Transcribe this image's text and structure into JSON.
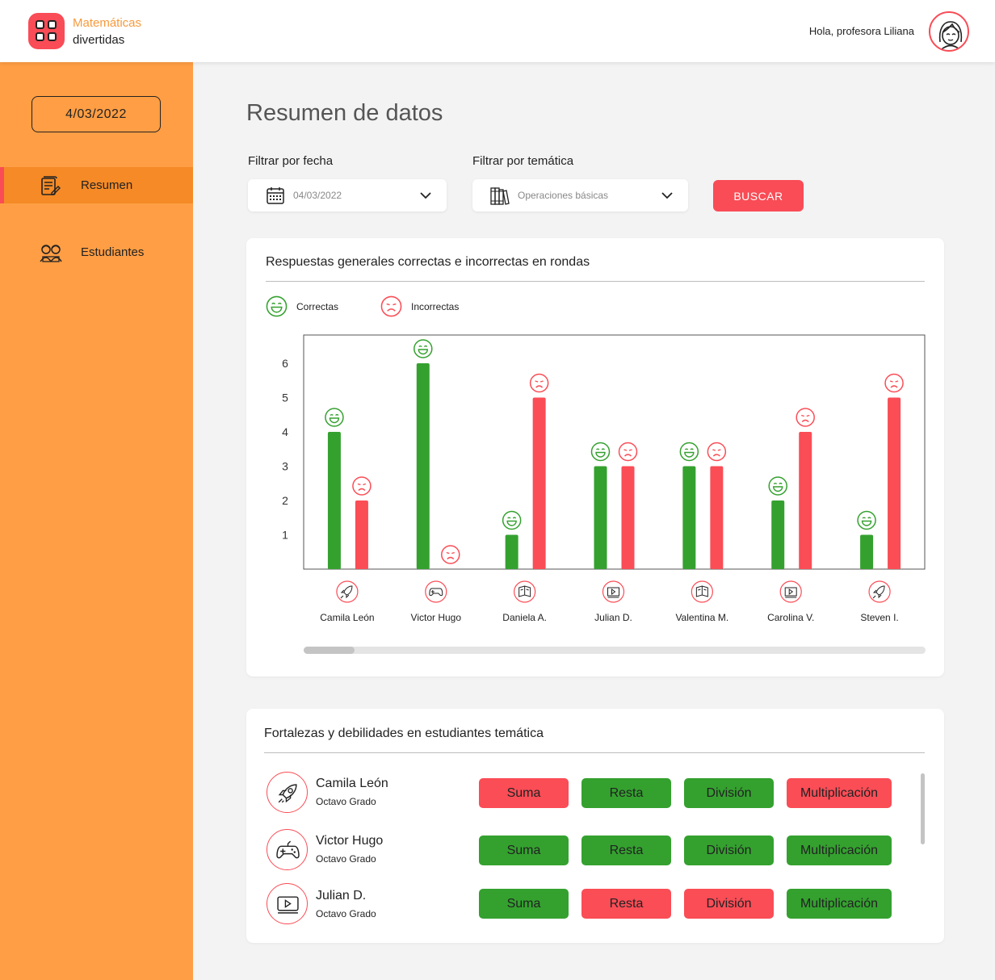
{
  "brand": {
    "line1": "Matemáticas",
    "line2": "divertidas"
  },
  "header": {
    "greeting": "Hola, profesora Liliana"
  },
  "sidebar": {
    "date": "4/03/2022",
    "items": [
      {
        "label": "Resumen",
        "icon": "report-icon",
        "active": true
      },
      {
        "label": "Estudiantes",
        "icon": "students-icon",
        "active": false
      }
    ]
  },
  "page": {
    "title": "Resumen de datos"
  },
  "filters": {
    "date_label": "Filtrar por fecha",
    "date_value": "04/03/2022",
    "topic_label": "Filtrar por temática",
    "topic_value": "Operaciones básicas",
    "search_label": "BUSCAR"
  },
  "colors": {
    "correct": "#34a12f",
    "incorrect": "#fa4d56",
    "orange": "#ff9e44",
    "accent": "#f94c56"
  },
  "chart_card": {
    "title": "Respuestas generales correctas e incorrectas en rondas",
    "legend": [
      {
        "label": "Correctas",
        "icon": "happy-face-icon"
      },
      {
        "label": "Incorrectas",
        "icon": "sad-face-icon"
      }
    ]
  },
  "chart_data": {
    "type": "bar",
    "title": "Respuestas generales correctas e incorrectas en rondas",
    "categories": [
      "Camila León",
      "Victor Hugo",
      "Daniela A.",
      "Julian D.",
      "Valentina M.",
      "Carolina V.",
      "Steven I."
    ],
    "category_icons": [
      "rocket-icon",
      "gamepad-icon",
      "book-icon",
      "video-icon",
      "book-icon",
      "video-icon",
      "rocket-icon"
    ],
    "series": [
      {
        "name": "Correctas",
        "values": [
          4,
          6,
          1,
          3,
          3,
          2,
          1
        ]
      },
      {
        "name": "Incorrectas",
        "values": [
          2,
          0,
          5,
          3,
          3,
          4,
          5
        ]
      }
    ],
    "yticks": [
      1,
      2,
      3,
      4,
      5,
      6
    ],
    "ylim": [
      0,
      6.5
    ],
    "legend": "top-left"
  },
  "strengths_card": {
    "title": "Fortalezas y debilidades en estudiantes temática",
    "students": [
      {
        "name": "Camila León",
        "grade": "Octavo Grado",
        "icon": "rocket-icon",
        "topics": [
          {
            "label": "Suma",
            "status": "bad"
          },
          {
            "label": "Resta",
            "status": "good"
          },
          {
            "label": "División",
            "status": "good"
          },
          {
            "label": "Multiplicación",
            "status": "bad"
          }
        ]
      },
      {
        "name": "Victor Hugo",
        "grade": "Octavo Grado",
        "icon": "gamepad-icon",
        "topics": [
          {
            "label": "Suma",
            "status": "good"
          },
          {
            "label": "Resta",
            "status": "good"
          },
          {
            "label": "División",
            "status": "good"
          },
          {
            "label": "Multiplicación",
            "status": "good"
          }
        ]
      },
      {
        "name": "Julian D.",
        "grade": "Octavo Grado",
        "icon": "video-icon",
        "topics": [
          {
            "label": "Suma",
            "status": "good"
          },
          {
            "label": "Resta",
            "status": "bad"
          },
          {
            "label": "División",
            "status": "bad"
          },
          {
            "label": "Multiplicación",
            "status": "good"
          }
        ]
      }
    ]
  }
}
